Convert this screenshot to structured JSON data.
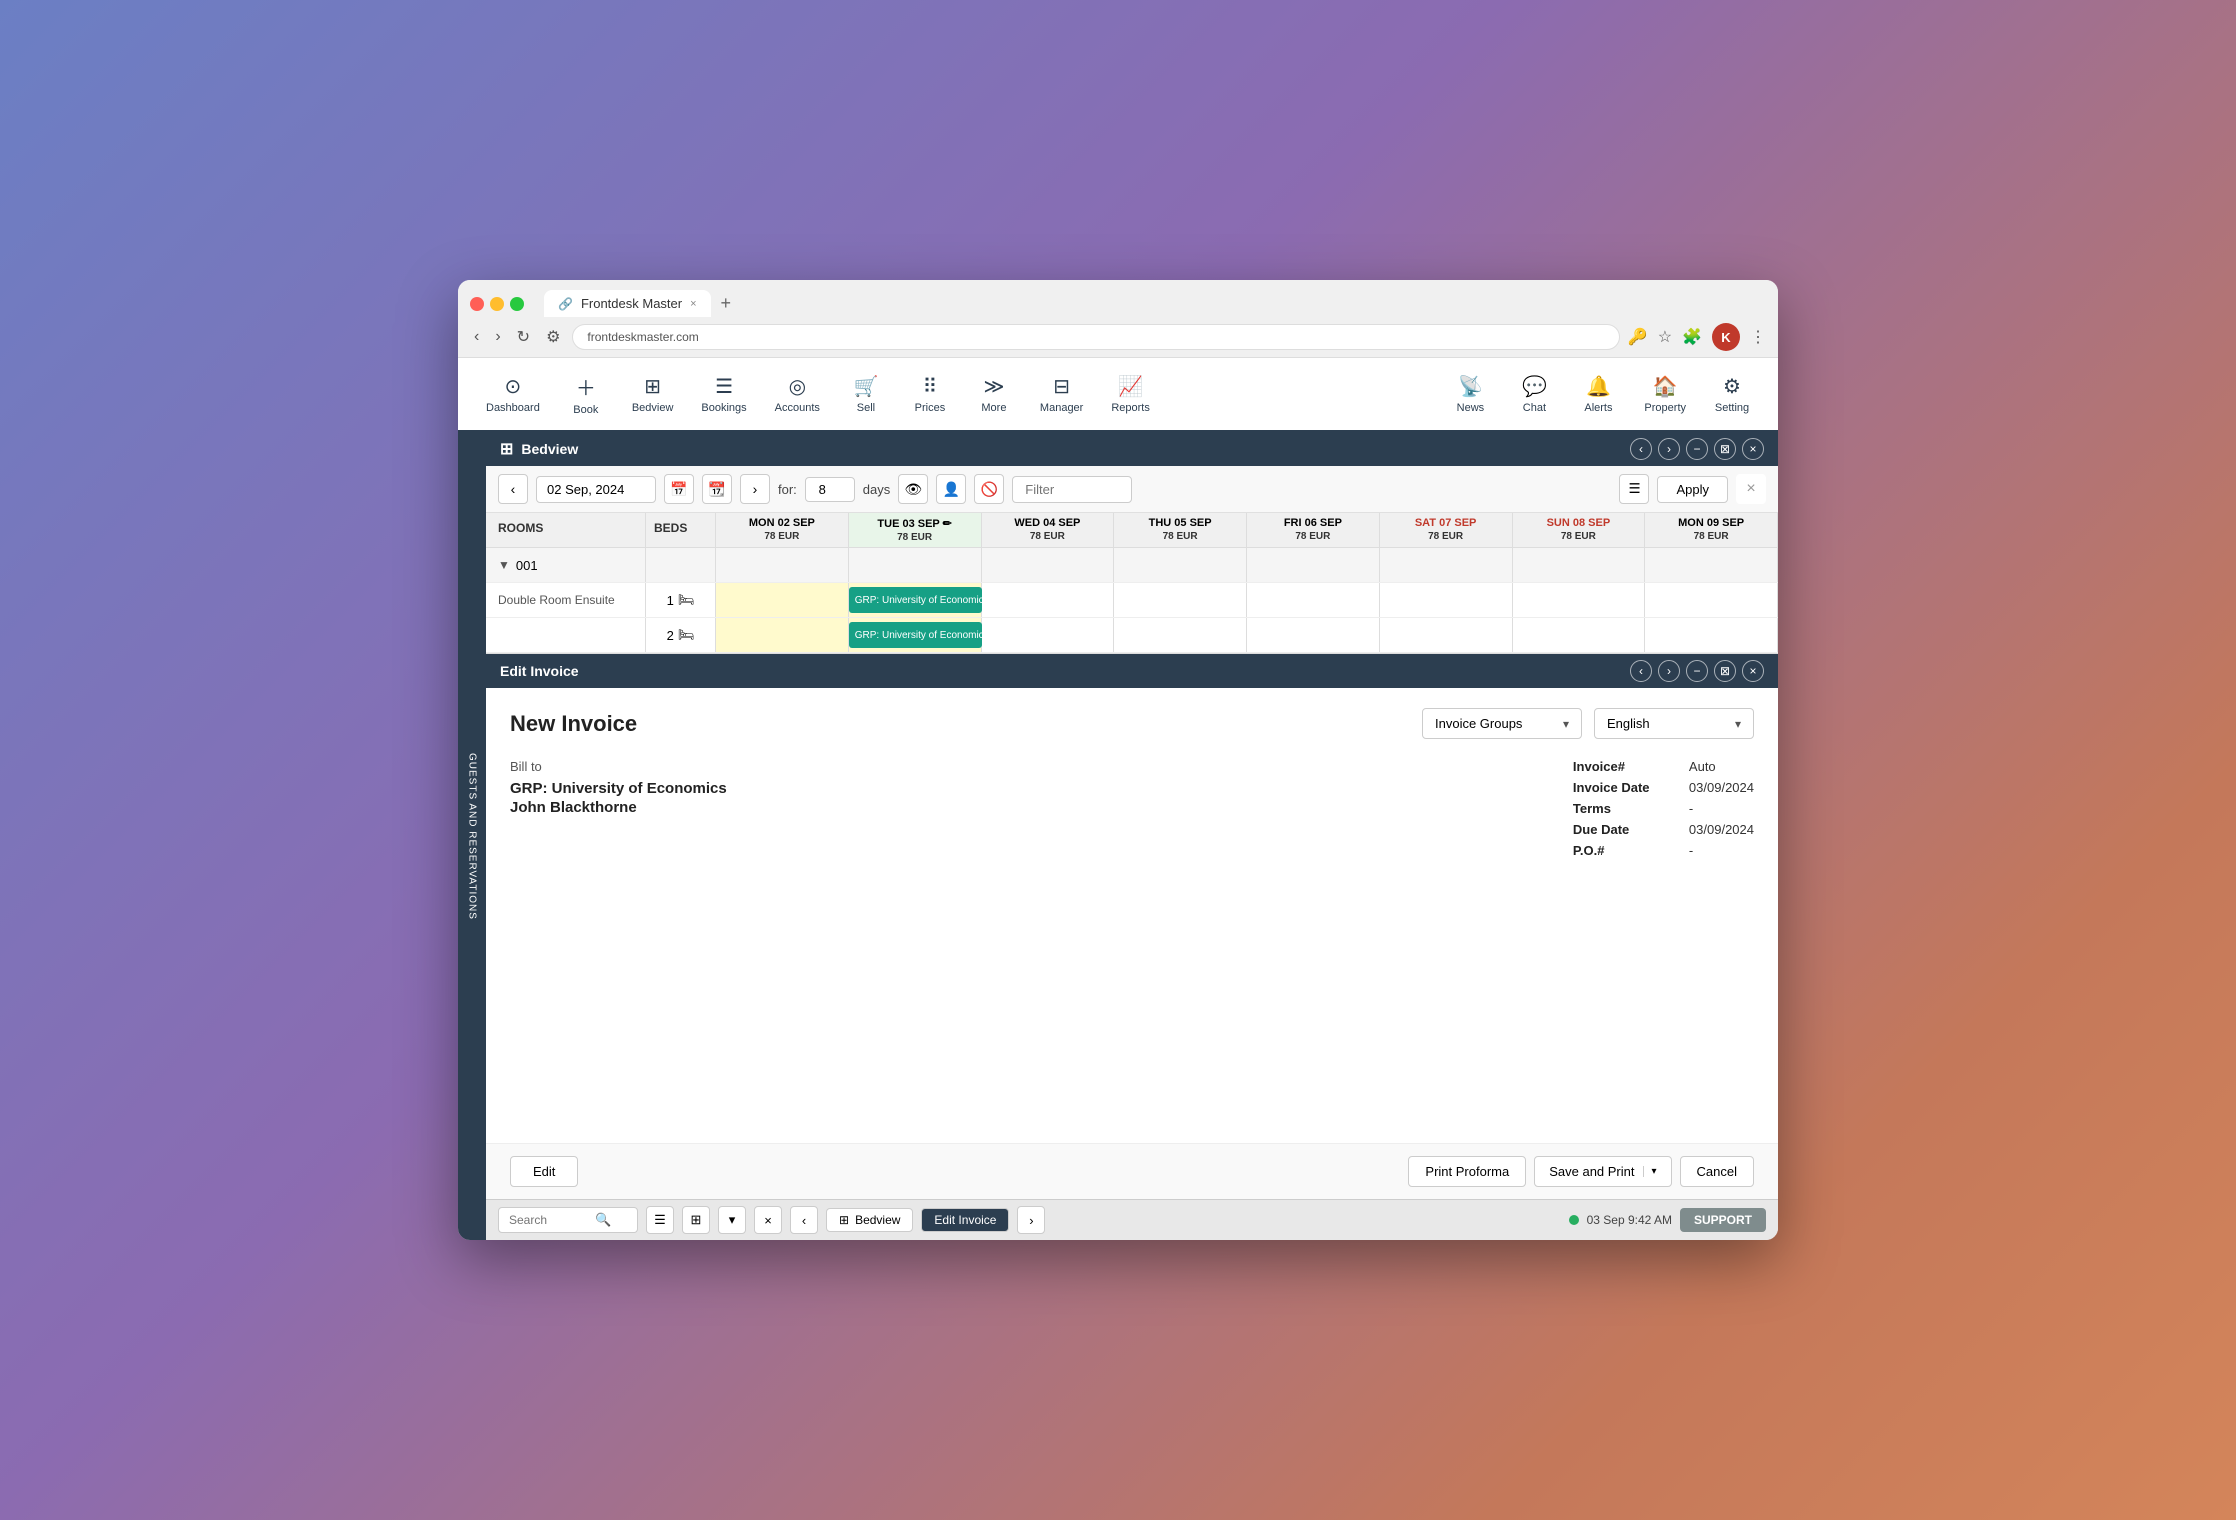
{
  "browser": {
    "tab_title": "Frontdesk Master",
    "tab_close": "×",
    "tab_new": "+",
    "nav_back": "‹",
    "nav_forward": "›",
    "nav_refresh": "↻",
    "nav_settings_icon": "⚙",
    "address_icon": "🔗",
    "bookmark_icon": "☆",
    "extensions_icon": "🧩",
    "user_initial": "K",
    "more_icon": "⋮"
  },
  "toolbar": {
    "items": [
      {
        "id": "dashboard",
        "icon": "⊙",
        "label": "Dashboard"
      },
      {
        "id": "book",
        "icon": "＋",
        "label": "Book"
      },
      {
        "id": "bedview",
        "icon": "⊞",
        "label": "Bedview"
      },
      {
        "id": "bookings",
        "icon": "☰",
        "label": "Bookings"
      },
      {
        "id": "accounts",
        "icon": "◎",
        "label": "Accounts"
      },
      {
        "id": "sell",
        "icon": "🛒",
        "label": "Sell"
      },
      {
        "id": "prices",
        "icon": "⠿",
        "label": "Prices"
      },
      {
        "id": "more",
        "icon": "≫",
        "label": "More"
      },
      {
        "id": "manager",
        "icon": "⊟",
        "label": "Manager"
      },
      {
        "id": "reports",
        "icon": "📈",
        "label": "Reports"
      },
      {
        "id": "news",
        "icon": "📡",
        "label": "News"
      },
      {
        "id": "chat",
        "icon": "💬",
        "label": "Chat"
      },
      {
        "id": "alerts",
        "icon": "🔔",
        "label": "Alerts"
      },
      {
        "id": "property",
        "icon": "🏠",
        "label": "Property"
      },
      {
        "id": "setting",
        "icon": "⚙",
        "label": "Setting"
      }
    ]
  },
  "sidebar": {
    "label": "GUESTS AND RESERVATIONS"
  },
  "bedview": {
    "title": "Bedview",
    "date": "02 Sep, 2024",
    "for_label": "for:",
    "days": "8",
    "days_label": "days",
    "filter_placeholder": "Filter",
    "apply_label": "Apply",
    "columns": {
      "rooms": "ROOMS",
      "beds": "BEDS"
    },
    "days_header": [
      {
        "label": "MON 02 SEP",
        "price": "78 EUR",
        "weekend": false
      },
      {
        "label": "TUE 03 SEP",
        "price": "78 EUR",
        "weekend": false,
        "current": true
      },
      {
        "label": "WED 04 SEP",
        "price": "78 EUR",
        "weekend": false
      },
      {
        "label": "THU 05 SEP",
        "price": "78 EUR",
        "weekend": false
      },
      {
        "label": "FRI 06 SEP",
        "price": "78 EUR",
        "weekend": false
      },
      {
        "label": "SAT 07 SEP",
        "price": "78 EUR",
        "weekend": true
      },
      {
        "label": "SUN 08 SEP",
        "price": "78 EUR",
        "weekend": true
      },
      {
        "label": "MON 09 SEP",
        "price": "78 EUR",
        "weekend": false
      }
    ],
    "rooms": [
      {
        "id": "room-001",
        "name": "001",
        "collapsed": true,
        "beds": [
          {
            "bed_number": 1,
            "bookings": [
              {
                "start_col": 1,
                "span": 1,
                "label": "GRP: University of Economics",
                "yellow_cols": [
                  0,
                  1
                ]
              }
            ]
          },
          {
            "bed_number": 2,
            "bookings": [
              {
                "start_col": 1,
                "span": 1,
                "label": "GRP: University of Economics",
                "yellow_cols": [
                  0,
                  1
                ]
              }
            ]
          }
        ],
        "room_type": "Double Room Ensuite"
      }
    ]
  },
  "invoice": {
    "panel_title": "Edit Invoice",
    "title": "New Invoice",
    "groups_label": "Invoice Groups",
    "language": "English",
    "bill_to_label": "Bill to",
    "client_name": "GRP: University of Economics",
    "client_contact": "John Blackthorne",
    "fields": [
      {
        "label": "Invoice#",
        "value": "Auto"
      },
      {
        "label": "Invoice Date",
        "value": "03/09/2024"
      },
      {
        "label": "Terms",
        "value": "-"
      },
      {
        "label": "Due Date",
        "value": "03/09/2024"
      },
      {
        "label": "P.O.#",
        "value": "-"
      }
    ],
    "edit_label": "Edit",
    "print_proforma_label": "Print Proforma",
    "save_print_label": "Save and Print",
    "cancel_label": "Cancel"
  },
  "bottom_bar": {
    "search_placeholder": "Search",
    "search_icon": "🔍",
    "menu_icon": "☰",
    "grid_icon": "⊞",
    "chevron_icon": "▾",
    "close_icon": "×",
    "prev_icon": "‹",
    "bedview_tab": "Bedview",
    "edit_invoice_tab": "Edit Invoice",
    "next_icon": "›",
    "status_time": "03 Sep 9:42 AM",
    "support_label": "SUPPORT"
  }
}
